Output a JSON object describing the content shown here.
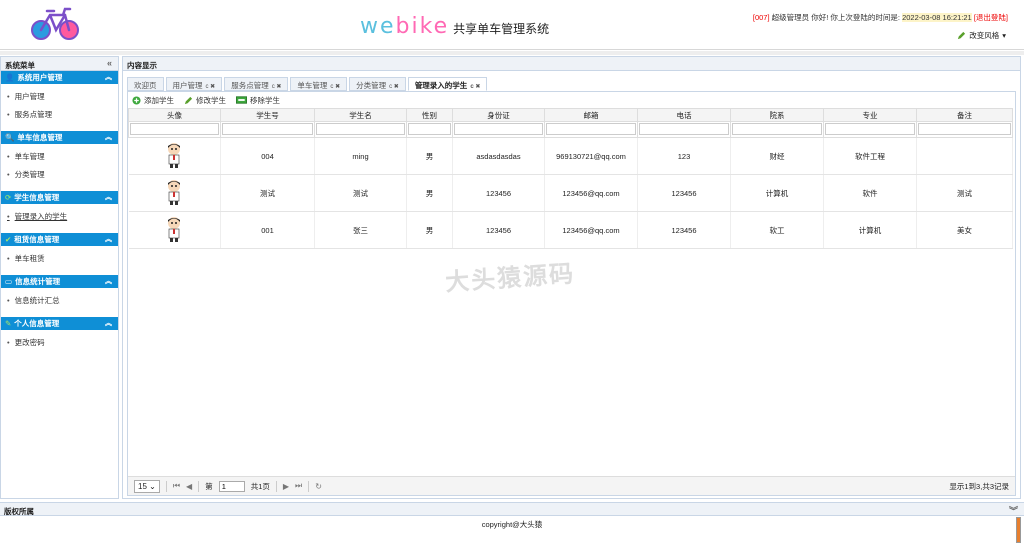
{
  "header": {
    "brand_we": "we",
    "brand_bike": "bike",
    "brand_sub": "共享单车管理系统",
    "user_code": "[007]",
    "greeting": "超级管理员 你好! 你上次登陆的时间是:",
    "last_login": "2022-03-08 16:21:21",
    "logout": "[退出登陆]",
    "change_style": "改变风格"
  },
  "sidebar": {
    "title": "系统菜单",
    "sections": [
      {
        "title": "系统用户管理",
        "items": [
          "用户管理",
          "服务点管理"
        ]
      },
      {
        "title": "单车信息管理",
        "items": [
          "单车管理",
          "分类管理"
        ]
      },
      {
        "title": "学生信息管理",
        "items": [
          "管理录入的学生"
        ]
      },
      {
        "title": "租赁信息管理",
        "items": [
          "单车租赁"
        ]
      },
      {
        "title": "信息统计管理",
        "items": [
          "信息统计汇总"
        ]
      },
      {
        "title": "个人信息管理",
        "items": [
          "更改密码"
        ]
      }
    ]
  },
  "content": {
    "title": "内容显示",
    "tabs": [
      "欢迎页",
      "用户管理",
      "服务点管理",
      "单车管理",
      "分类管理",
      "管理录入的学生"
    ],
    "toolbar": {
      "add": "添加学生",
      "edit": "修改学生",
      "remove": "移除学生"
    },
    "columns": [
      "头像",
      "学生号",
      "学生名",
      "性别",
      "身份证",
      "邮箱",
      "电话",
      "院系",
      "专业",
      "备注"
    ],
    "rows": [
      {
        "no": "004",
        "name": "ming",
        "sex": "男",
        "id": "asdasdasdas",
        "email": "969130721@qq.com",
        "phone": "123",
        "dept": "财经",
        "major": "软件工程",
        "note": ""
      },
      {
        "no": "测试",
        "name": "测试",
        "sex": "男",
        "id": "123456",
        "email": "123456@qq.com",
        "phone": "123456",
        "dept": "计算机",
        "major": "软件",
        "note": "测试"
      },
      {
        "no": "001",
        "name": "张三",
        "sex": "男",
        "id": "123456",
        "email": "123456@qq.com",
        "phone": "123456",
        "dept": "软工",
        "major": "计算机",
        "note": "美女"
      }
    ],
    "pager": {
      "page_size": "15",
      "page_label": "第",
      "page": "1",
      "total_pages": "共1页",
      "info": "显示1到3,共3记录"
    }
  },
  "watermark": "大头猿源码",
  "footer": {
    "title": "版权所属",
    "copyright": "copyright@大头猿"
  },
  "colors": {
    "accent": "#0f8fd6",
    "panel_border": "#c9d6e6"
  }
}
